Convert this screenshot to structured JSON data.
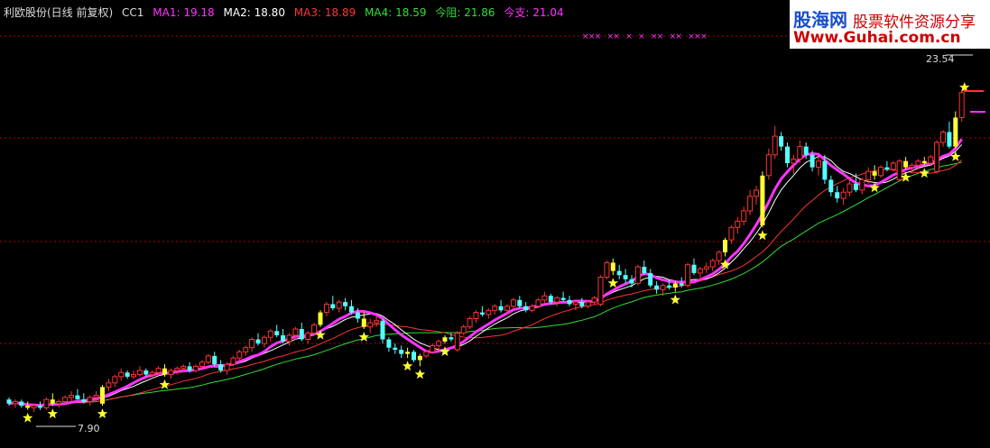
{
  "header": {
    "title": "利欧股份(日线 前复权)",
    "indicator": "CC1",
    "ma1": {
      "label": "MA1:",
      "value": "19.18",
      "color": "#ff33ff"
    },
    "ma2": {
      "label": "MA2:",
      "value": "18.80",
      "color": "#ffffff"
    },
    "ma3": {
      "label": "MA3:",
      "value": "18.89",
      "color": "#ff3333"
    },
    "ma4": {
      "label": "MA4:",
      "value": "18.59",
      "color": "#33dd33"
    },
    "resist": {
      "label": "今阻:",
      "value": "21.86",
      "color": "#33dd33"
    },
    "support": {
      "label": "今支:",
      "value": "21.04",
      "color": "#ff33ff"
    }
  },
  "watermark": {
    "line1a": "股海网",
    "line1b": "股票软件资源分享",
    "line2": "Www.Guhai.com.cn"
  },
  "annotations": {
    "high": "23.54",
    "low": "7.90"
  },
  "colors": {
    "up": "#ff3333",
    "down": "#55ffff",
    "signal": "#ffff33",
    "ma1": "#ff33ff",
    "ma2": "#ffffff",
    "ma3": "#ff3333",
    "ma4": "#33dd33",
    "grid": "#aa0000"
  },
  "chart_data": {
    "type": "candlestick",
    "ylim": [
      7.0,
      25.0
    ],
    "grid": true,
    "candles": [
      [
        8.6,
        8.7,
        8.3,
        8.4
      ],
      [
        8.4,
        8.6,
        8.2,
        8.5
      ],
      [
        8.5,
        8.6,
        8.2,
        8.3
      ],
      [
        8.3,
        8.5,
        8.1,
        8.2
      ],
      [
        8.2,
        8.4,
        8.0,
        8.3
      ],
      [
        8.3,
        8.5,
        8.1,
        8.2
      ],
      [
        8.2,
        8.7,
        8.1,
        8.6
      ],
      [
        8.6,
        8.9,
        8.3,
        8.4
      ],
      [
        8.4,
        8.6,
        8.2,
        8.5
      ],
      [
        8.5,
        8.8,
        8.4,
        8.7
      ],
      [
        8.7,
        9.0,
        8.5,
        8.8
      ],
      [
        8.8,
        9.1,
        8.6,
        8.6
      ],
      [
        8.6,
        8.9,
        8.4,
        8.5
      ],
      [
        8.5,
        8.8,
        8.3,
        8.7
      ],
      [
        8.7,
        9.0,
        8.5,
        8.8
      ],
      [
        8.4,
        9.3,
        8.3,
        9.2
      ],
      [
        9.2,
        9.6,
        9.0,
        9.4
      ],
      [
        9.4,
        9.8,
        9.2,
        9.7
      ],
      [
        9.7,
        10.1,
        9.5,
        9.9
      ],
      [
        9.9,
        10.0,
        9.6,
        9.7
      ],
      [
        9.7,
        10.0,
        9.6,
        9.8
      ],
      [
        9.8,
        10.2,
        9.7,
        10.0
      ],
      [
        10.0,
        10.1,
        9.7,
        9.8
      ],
      [
        9.8,
        10.0,
        9.6,
        9.9
      ],
      [
        9.9,
        10.2,
        9.8,
        10.1
      ],
      [
        10.1,
        10.3,
        9.7,
        9.8
      ],
      [
        9.8,
        10.1,
        9.6,
        10.0
      ],
      [
        10.0,
        10.2,
        9.8,
        10.1
      ],
      [
        10.1,
        10.3,
        9.9,
        10.2
      ],
      [
        10.2,
        10.4,
        9.9,
        10.0
      ],
      [
        10.0,
        10.3,
        9.9,
        10.2
      ],
      [
        10.2,
        10.5,
        10.0,
        10.4
      ],
      [
        10.4,
        10.8,
        10.3,
        10.7
      ],
      [
        10.7,
        10.9,
        10.2,
        10.3
      ],
      [
        10.3,
        10.5,
        9.9,
        10.0
      ],
      [
        10.0,
        10.4,
        9.8,
        10.3
      ],
      [
        10.3,
        10.7,
        10.2,
        10.6
      ],
      [
        10.6,
        11.0,
        10.5,
        10.9
      ],
      [
        10.9,
        11.2,
        10.7,
        11.1
      ],
      [
        11.1,
        11.6,
        10.9,
        11.5
      ],
      [
        11.5,
        11.8,
        11.2,
        11.3
      ],
      [
        11.3,
        11.7,
        11.1,
        11.6
      ],
      [
        11.6,
        12.0,
        11.4,
        11.9
      ],
      [
        11.9,
        12.2,
        11.6,
        11.7
      ],
      [
        11.7,
        12.0,
        11.3,
        11.4
      ],
      [
        11.4,
        11.8,
        11.2,
        11.7
      ],
      [
        11.7,
        12.1,
        11.5,
        12.0
      ],
      [
        12.0,
        12.3,
        11.4,
        11.5
      ],
      [
        11.5,
        11.9,
        11.3,
        11.8
      ],
      [
        11.8,
        12.3,
        11.7,
        12.2
      ],
      [
        12.2,
        12.9,
        12.1,
        12.8
      ],
      [
        12.8,
        13.3,
        12.6,
        13.2
      ],
      [
        13.2,
        13.6,
        12.9,
        13.0
      ],
      [
        13.0,
        13.4,
        12.8,
        13.3
      ],
      [
        13.3,
        13.5,
        12.9,
        13.1
      ],
      [
        13.1,
        13.4,
        12.7,
        12.8
      ],
      [
        12.8,
        13.0,
        12.3,
        12.5
      ],
      [
        12.5,
        12.8,
        12.0,
        12.1
      ],
      [
        12.1,
        12.5,
        11.8,
        12.3
      ],
      [
        12.3,
        12.6,
        12.1,
        12.4
      ],
      [
        12.4,
        12.5,
        11.3,
        11.5
      ],
      [
        11.5,
        11.6,
        10.9,
        11.1
      ],
      [
        11.1,
        11.3,
        10.8,
        11.0
      ],
      [
        11.0,
        11.2,
        10.6,
        10.8
      ],
      [
        10.8,
        11.1,
        10.6,
        10.9
      ],
      [
        10.9,
        11.0,
        10.4,
        10.5
      ],
      [
        10.5,
        10.8,
        10.2,
        10.7
      ],
      [
        10.7,
        11.0,
        10.6,
        10.9
      ],
      [
        10.9,
        11.3,
        10.8,
        11.2
      ],
      [
        11.2,
        11.5,
        11.0,
        11.4
      ],
      [
        11.4,
        11.7,
        11.3,
        11.6
      ],
      [
        11.6,
        11.8,
        11.4,
        11.5
      ],
      [
        11.0,
        11.9,
        10.9,
        11.8
      ],
      [
        11.8,
        12.2,
        11.7,
        12.1
      ],
      [
        12.1,
        12.6,
        12.0,
        12.5
      ],
      [
        12.5,
        12.9,
        12.3,
        12.8
      ],
      [
        12.8,
        13.1,
        12.6,
        12.7
      ],
      [
        12.7,
        13.0,
        12.5,
        12.9
      ],
      [
        12.9,
        13.2,
        12.7,
        13.1
      ],
      [
        13.1,
        13.4,
        12.8,
        12.9
      ],
      [
        12.9,
        13.2,
        12.7,
        13.1
      ],
      [
        13.1,
        13.5,
        13.0,
        13.4
      ],
      [
        13.4,
        13.6,
        13.0,
        13.1
      ],
      [
        13.1,
        13.3,
        12.8,
        12.9
      ],
      [
        12.9,
        13.2,
        12.8,
        13.1
      ],
      [
        13.1,
        13.5,
        13.0,
        13.4
      ],
      [
        13.4,
        13.8,
        13.2,
        13.6
      ],
      [
        13.6,
        13.7,
        13.2,
        13.3
      ],
      [
        13.3,
        13.6,
        13.1,
        13.5
      ],
      [
        13.5,
        13.8,
        13.3,
        13.4
      ],
      [
        13.4,
        13.6,
        13.1,
        13.2
      ],
      [
        13.2,
        13.4,
        12.9,
        13.3
      ],
      [
        13.3,
        13.5,
        13.0,
        13.1
      ],
      [
        13.1,
        13.4,
        13.0,
        13.3
      ],
      [
        13.3,
        13.6,
        13.2,
        13.5
      ],
      [
        13.2,
        14.6,
        13.1,
        14.5
      ],
      [
        14.5,
        15.3,
        14.4,
        15.2
      ],
      [
        15.2,
        15.4,
        14.6,
        14.8
      ],
      [
        14.8,
        15.1,
        14.4,
        14.6
      ],
      [
        14.6,
        14.9,
        14.2,
        14.4
      ],
      [
        14.4,
        14.6,
        14.0,
        14.2
      ],
      [
        14.2,
        15.1,
        14.1,
        15.0
      ],
      [
        15.0,
        15.3,
        14.6,
        14.7
      ],
      [
        14.7,
        14.9,
        14.0,
        14.1
      ],
      [
        14.1,
        14.3,
        13.7,
        13.9
      ],
      [
        13.9,
        14.2,
        13.6,
        14.1
      ],
      [
        14.1,
        14.4,
        13.9,
        14.0
      ],
      [
        14.0,
        14.3,
        13.8,
        14.2
      ],
      [
        14.2,
        14.5,
        14.0,
        14.1
      ],
      [
        14.1,
        15.2,
        14.0,
        15.1
      ],
      [
        15.1,
        15.4,
        14.6,
        14.7
      ],
      [
        14.7,
        15.0,
        14.3,
        14.9
      ],
      [
        14.9,
        15.2,
        14.7,
        15.0
      ],
      [
        15.0,
        15.4,
        14.8,
        15.3
      ],
      [
        15.3,
        15.8,
        15.1,
        15.7
      ],
      [
        15.7,
        16.4,
        15.5,
        16.3
      ],
      [
        16.3,
        17.0,
        16.1,
        16.9
      ],
      [
        16.9,
        17.4,
        16.6,
        17.2
      ],
      [
        17.2,
        17.9,
        17.0,
        17.7
      ],
      [
        17.7,
        18.7,
        17.5,
        18.4
      ],
      [
        18.4,
        18.9,
        18.0,
        18.7
      ],
      [
        17.0,
        19.6,
        16.9,
        19.4
      ],
      [
        19.4,
        20.7,
        19.2,
        20.4
      ],
      [
        20.4,
        21.8,
        20.2,
        21.3
      ],
      [
        21.3,
        21.5,
        20.6,
        20.8
      ],
      [
        20.8,
        21.0,
        19.8,
        20.0
      ],
      [
        20.0,
        20.4,
        19.5,
        20.2
      ],
      [
        20.2,
        21.1,
        20.0,
        20.8
      ],
      [
        20.8,
        21.0,
        20.2,
        20.4
      ],
      [
        20.4,
        20.6,
        19.6,
        19.8
      ],
      [
        19.8,
        20.3,
        19.4,
        20.1
      ],
      [
        20.1,
        20.4,
        19.0,
        19.2
      ],
      [
        19.2,
        19.4,
        18.4,
        18.6
      ],
      [
        18.6,
        18.9,
        18.1,
        18.3
      ],
      [
        18.3,
        18.8,
        18.0,
        18.6
      ],
      [
        18.6,
        19.2,
        18.4,
        19.0
      ],
      [
        19.0,
        19.5,
        18.6,
        18.7
      ],
      [
        18.7,
        19.3,
        18.5,
        19.2
      ],
      [
        19.2,
        19.8,
        19.0,
        19.6
      ],
      [
        19.6,
        19.9,
        19.2,
        19.4
      ],
      [
        19.4,
        19.9,
        19.3,
        19.8
      ],
      [
        19.8,
        20.1,
        19.6,
        19.7
      ],
      [
        19.7,
        20.1,
        19.6,
        20.0
      ],
      [
        19.2,
        20.2,
        19.1,
        20.1
      ],
      [
        20.1,
        20.3,
        19.7,
        19.8
      ],
      [
        19.8,
        20.0,
        19.5,
        19.9
      ],
      [
        19.9,
        20.2,
        19.7,
        20.1
      ],
      [
        20.1,
        20.3,
        19.9,
        20.0
      ],
      [
        20.0,
        20.4,
        19.9,
        20.3
      ],
      [
        19.6,
        21.1,
        19.5,
        21.0
      ],
      [
        21.0,
        21.6,
        20.8,
        21.5
      ],
      [
        21.5,
        22.0,
        20.7,
        20.8
      ],
      [
        20.8,
        22.5,
        20.7,
        22.2
      ],
      [
        22.2,
        23.5,
        22.0,
        23.4
      ]
    ],
    "signals": [
      3,
      7,
      15,
      25,
      50,
      57,
      64,
      66,
      70,
      97,
      107,
      115,
      121,
      139,
      144,
      147,
      152
    ],
    "x_marks": [
      91,
      92,
      93,
      95,
      96,
      98,
      100,
      102,
      103,
      105,
      106,
      108,
      109,
      110
    ]
  }
}
